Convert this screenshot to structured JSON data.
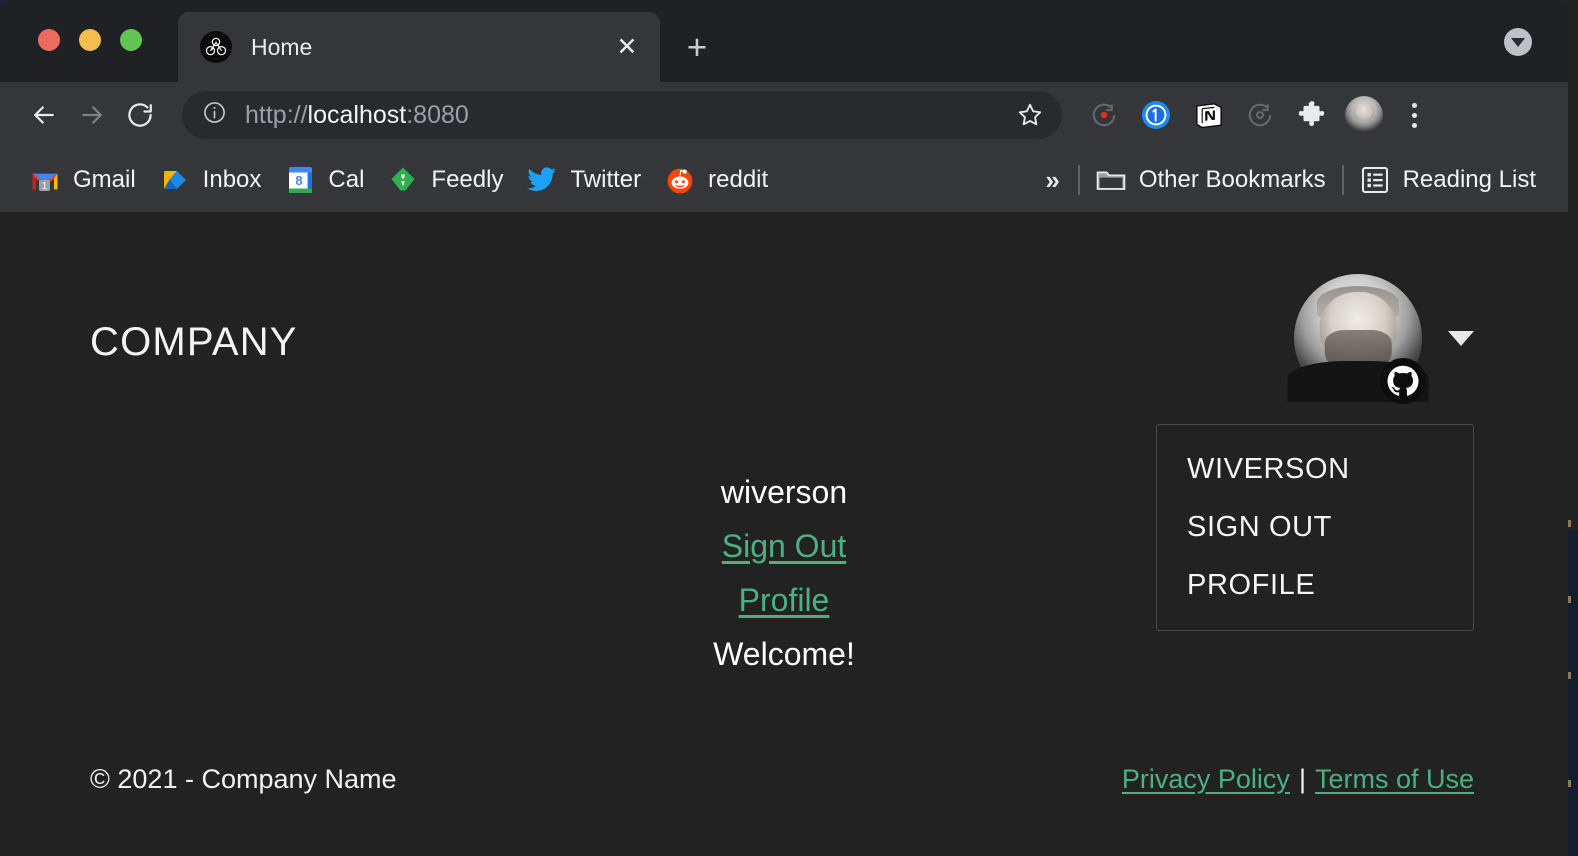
{
  "window": {
    "traffic_lights": [
      {
        "name": "close",
        "color": "#ED6B5E"
      },
      {
        "name": "minimize",
        "color": "#F4BE4F"
      },
      {
        "name": "zoom",
        "color": "#61C454"
      }
    ]
  },
  "tabs": [
    {
      "title": "Home",
      "favicon": "bicycle-graph-icon",
      "close_label": "✕"
    }
  ],
  "tabstrip": {
    "new_tab_label": "+",
    "tab_search_icon": "chevron-down-icon"
  },
  "toolbar": {
    "back_icon": "arrow-left-icon",
    "forward_icon": "arrow-right-icon",
    "reload_icon": "reload-icon",
    "info_icon": "info-circle-icon",
    "star_icon": "star-icon",
    "url": {
      "scheme": "http://",
      "host": "localhost",
      "port": ":8080",
      "full": "http://localhost:8080"
    },
    "extensions": [
      {
        "name": "recording-extension-icon",
        "color": "#6E7074"
      },
      {
        "name": "onepassword-extension-icon",
        "color": "#1A8CFF"
      },
      {
        "name": "notion-extension-icon",
        "color": "#FFFFFF"
      },
      {
        "name": "loom-extension-icon",
        "color": "#6E7074"
      },
      {
        "name": "puzzle-extensions-icon",
        "color": "#E8EAED"
      }
    ],
    "profile_avatar": "user-avatar",
    "menu_icon": "three-dot-menu-icon"
  },
  "bookmarks": {
    "items": [
      {
        "label": "Gmail",
        "icon": "gmail-icon",
        "badge": "1"
      },
      {
        "label": "Inbox",
        "icon": "inbox-icon"
      },
      {
        "label": "Cal",
        "icon": "google-calendar-icon",
        "badge": "8"
      },
      {
        "label": "Feedly",
        "icon": "feedly-icon"
      },
      {
        "label": "Twitter",
        "icon": "twitter-icon"
      },
      {
        "label": "reddit",
        "icon": "reddit-icon"
      }
    ],
    "overflow_label": "»",
    "other_bookmarks": {
      "label": "Other Bookmarks",
      "icon": "folder-icon"
    },
    "reading_list": {
      "label": "Reading List",
      "icon": "reading-list-icon"
    }
  },
  "page": {
    "logo": "COMPANY",
    "account": {
      "avatar": "user-avatar",
      "provider_badge": "github-icon",
      "caret": "caret-down-icon",
      "menu": [
        "WIVERSON",
        "SIGN OUT",
        "PROFILE"
      ]
    },
    "main": {
      "username": "wiverson",
      "sign_out_link": "Sign Out",
      "profile_link": "Profile",
      "welcome": "Welcome!"
    },
    "footer": {
      "copyright": "© 2021 - Company Name",
      "privacy_link": "Privacy Policy",
      "separator": "|",
      "terms_link": "Terms of Use"
    },
    "colors": {
      "background": "#222222",
      "link_green": "#4BB183",
      "text": "#FFFFFF"
    }
  }
}
